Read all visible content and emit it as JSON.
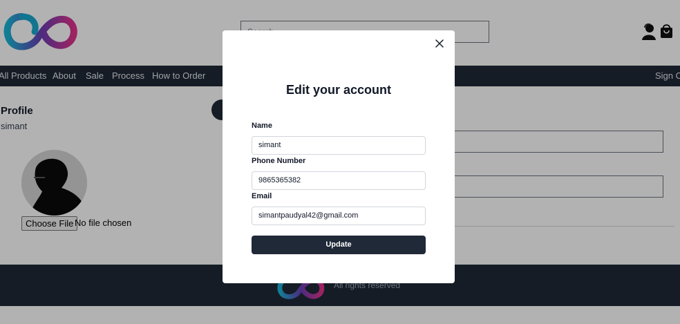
{
  "header": {
    "search_placeholder": "Search",
    "logo_icon": "infinity-logo-icon",
    "user_icon": "user-icon",
    "cart_icon": "shopping-bag-icon"
  },
  "nav": {
    "items": [
      "All Products",
      "About",
      "Sale",
      "Process",
      "How to Order"
    ],
    "sign_out": "Sign Out"
  },
  "profile": {
    "title": "Profile",
    "username": "simant",
    "file_button": "Choose File",
    "file_status": "No file chosen"
  },
  "footer": {
    "text": "All rights reserved"
  },
  "modal": {
    "title": "Edit your account",
    "close_icon": "close-icon",
    "fields": {
      "name": {
        "label": "Name",
        "value": "simant"
      },
      "phone": {
        "label": "Phone Number",
        "value": "9865365382"
      },
      "email": {
        "label": "Email",
        "value": "simantpaudyal42@gmail.com"
      }
    },
    "submit_label": "Update"
  },
  "colors": {
    "navbar": "#1f2937",
    "button": "#1f2937",
    "overlay": "rgba(0,0,0,0.30)"
  }
}
